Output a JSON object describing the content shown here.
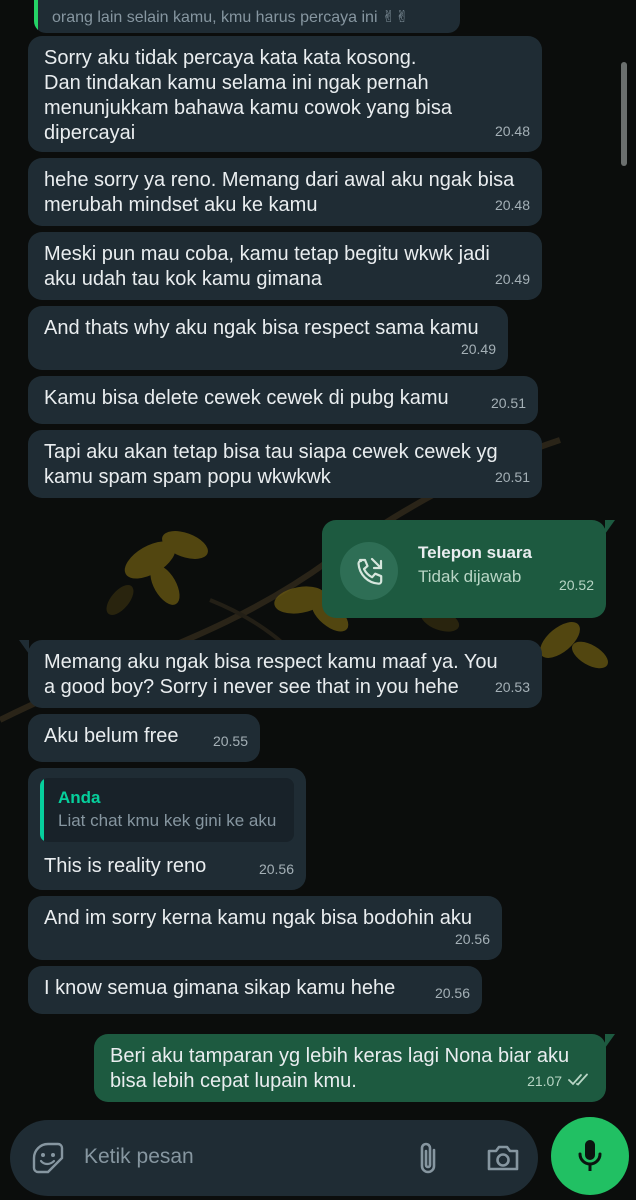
{
  "conversation": {
    "quoted_top": {
      "text": "orang lain selain kamu, kmu harus percaya ini ✌✌"
    },
    "messages": [
      {
        "text": "Sorry aku tidak percaya kata kata kosong.\nDan tindakan kamu selama ini ngak pernah\nmenunjukkam bahawa kamu cowok yang bisa\ndipercayai",
        "time": "20.48"
      },
      {
        "text": "hehe sorry ya reno. Memang dari awal aku ngak bisa\nmerubah mindset aku ke kamu",
        "time": "20.48"
      },
      {
        "text": "Meski pun mau coba, kamu tetap begitu wkwk jadi\naku udah tau kok kamu gimana",
        "time": "20.49"
      },
      {
        "text": "And thats why aku ngak bisa respect sama kamu",
        "time": "20.49"
      },
      {
        "text": "Kamu bisa delete cewek cewek di pubg kamu",
        "time": "20.51"
      },
      {
        "text": "Tapi aku akan tetap bisa tau siapa cewek cewek yg\nkamu spam spam popu wkwkwk",
        "time": "20.51"
      },
      {
        "text": "Memang aku ngak bisa respect kamu maaf ya. You\na good boy? Sorry i never see that in you hehe",
        "time": "20.53"
      },
      {
        "text": "Aku belum free",
        "time": "20.55"
      },
      {
        "text": "This is reality reno",
        "time": "20.56",
        "quote": {
          "author": "Anda",
          "text": "Liat chat kmu kek gini ke aku"
        }
      },
      {
        "text": "And im sorry kerna kamu ngak bisa bodohin aku",
        "time": "20.56"
      },
      {
        "text": "I know semua gimana sikap kamu hehe",
        "time": "20.56"
      }
    ],
    "call": {
      "title": "Telepon suara",
      "status": "Tidak dijawab",
      "time": "20.52",
      "icon": "missed-call-icon"
    },
    "sent": {
      "text": "Beri aku tamparan yg lebih keras lagi Nona biar aku\nbisa lebih cepat lupain kmu.",
      "time": "21.07",
      "status_icon": "double-check-icon"
    }
  },
  "input": {
    "placeholder": "Ketik pesan",
    "icons": [
      "emoji-icon",
      "attachment-icon",
      "camera-icon",
      "microphone-icon"
    ]
  },
  "colors": {
    "incoming_bubble": "#1f2c34",
    "outgoing_bubble": "#1d5a40",
    "accent": "#21c063",
    "background": "#0b0d0c"
  }
}
